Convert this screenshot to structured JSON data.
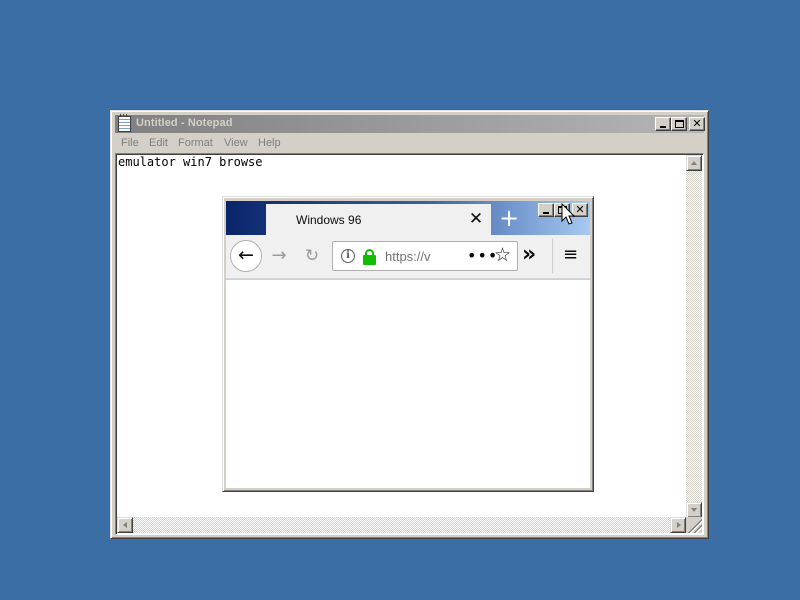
{
  "desktop": {
    "background_color": "#3a6ea5"
  },
  "notepad": {
    "title": "Untitled - Notepad",
    "menu": [
      "File",
      "Edit",
      "Format",
      "View",
      "Help"
    ],
    "content": "emulator win7 browse",
    "caption_buttons": {
      "minimize_icon": "minimize-icon",
      "maximize_icon": "maximize-icon",
      "close_icon": "close-icon"
    }
  },
  "browser": {
    "tab_title": "Windows 96",
    "tab_close": "✕",
    "new_tab": "+",
    "back": "←",
    "forward": "→",
    "reload": "↻",
    "url_text": "https://v",
    "page_actions": "•••",
    "bookmark": "☆",
    "overflow": "»",
    "menu": "≡",
    "accent_color": "#0a246a",
    "lock_color": "#12bc00"
  }
}
